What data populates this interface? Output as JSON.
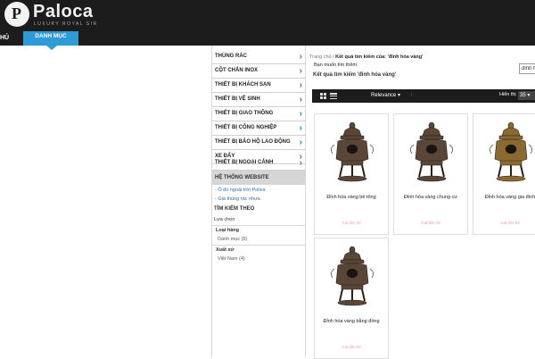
{
  "header": {
    "brand": "Paloca",
    "logo_letter": "P",
    "tagline": "LUXURY ROYAL SIR",
    "search_value": "đỉnh hóa vàng"
  },
  "nav": {
    "prev_label": "HỦ",
    "active_tab": "DANH MỤC"
  },
  "sidebar": {
    "categories": [
      "THÙNG RÁC",
      "CỘT CHẮN INOX",
      "THIẾT BỊ KHÁCH SẠN",
      "THIẾT BỊ VỆ SINH",
      "THIẾT BỊ GIAO THÔNG",
      "THIẾT BỊ CÔNG NGHIỆP",
      "THIẾT BỊ BẢO HỘ LAO ĐỘNG",
      "XE ĐẨY",
      "THIẾT BỊ NGOẠI CẢNH"
    ],
    "arrow": "›",
    "system_header": "HỆ THỐNG WEBSITE",
    "system_links": [
      "- Ô dù ngoài trời Poliva",
      "- Giá thùng rác nhựa"
    ],
    "filter_header": "TÌM KIẾM THEO",
    "filter_choose": "Lựa chọn",
    "filters": [
      {
        "title": "Loại hàng",
        "value": "Danh mục (5)"
      },
      {
        "title": "Xuất xứ",
        "value": "Việt Nam (4)"
      }
    ]
  },
  "main": {
    "breadcrumb_home": "Trang chủ",
    "breadcrumb_sep": " / ",
    "breadcrumb_current": "Kết quả tìm kiếm của: 'đỉnh hóa vàng'",
    "query_note": "Bạn muốn tìm thêm:",
    "results_title": "Kết quả tìm kiếm 'đỉnh hóa vàng'",
    "sort_label": "Relevance",
    "sort_caret": "▾",
    "sort_dir_icon": "↓",
    "show_label": "Hiển thị",
    "show_value": "35 ▾"
  },
  "products": [
    {
      "name": "Đỉnh hóa vàng bê tông",
      "price": "Giá liên hệ",
      "finish": "bronze"
    },
    {
      "name": "Đỉnh hóa vàng chung cư",
      "price": "Giá liên hệ",
      "finish": "bronze"
    },
    {
      "name": "Đỉnh hóa vàng gia đình",
      "price": "Giá liên hệ",
      "finish": "gold"
    },
    {
      "name": "Đỉnh hóa vàng bằng đồng",
      "price": "Giá liên hệ",
      "finish": "bronze"
    }
  ],
  "colors": {
    "topbar": "#1c1c1c",
    "accent": "#2e9bd6",
    "link": "#2e6fb0",
    "price": "#e8a0a0",
    "bronze": "#5a4636",
    "gold": "#8a6a30"
  }
}
